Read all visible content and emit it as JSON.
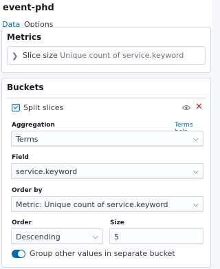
{
  "header": {
    "title": "event-phd",
    "tabs": [
      {
        "label": "Data",
        "active": true
      },
      {
        "label": "Options",
        "active": false
      }
    ]
  },
  "metrics": {
    "title": "Metrics",
    "item": {
      "label": "Slice size",
      "description": "Unique count of service.keyword"
    }
  },
  "buckets": {
    "title": "Buckets",
    "split": {
      "label": "Split slices",
      "aggregation_label": "Aggregation",
      "aggregation_help": "Terms help",
      "aggregation_value": "Terms",
      "field_label": "Field",
      "field_value": "service.keyword",
      "order_by_label": "Order by",
      "order_by_value": "Metric: Unique count of service.keyword",
      "order_label": "Order",
      "order_value": "Descending",
      "size_label": "Size",
      "size_value": "5",
      "group_other_label": "Group other values in separate bucket",
      "group_other_enabled": true
    }
  },
  "colors": {
    "accent": "#006bb4",
    "danger": "#bd271e",
    "border": "#d3dae6",
    "background": "#f5f7fa"
  },
  "icons": {
    "metric_expand": "chevron-right-icon",
    "split_toggle": "checkbox-icon",
    "visibility": "eye-icon",
    "remove": "close-icon",
    "select_arrow": "chevron-down-icon"
  }
}
